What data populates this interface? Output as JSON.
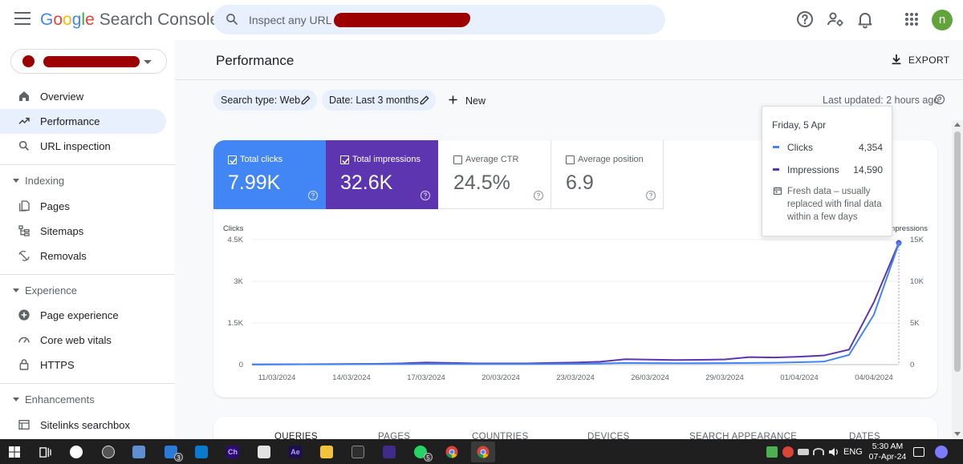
{
  "header": {
    "logo_letters": [
      "G",
      "o",
      "o",
      "g",
      "l",
      "e"
    ],
    "product_name": "Search Console",
    "search_placeholder": "Inspect any URL in",
    "help_icon": "help-icon",
    "account_icon": "manage-users-icon",
    "notifications_icon": "bell-icon",
    "apps_icon": "apps-grid-icon",
    "avatar_letter": "n"
  },
  "sidebar": {
    "items": [
      {
        "label": "Overview",
        "icon": "home-icon"
      },
      {
        "label": "Performance",
        "icon": "trending-up-icon",
        "active": true
      },
      {
        "label": "URL inspection",
        "icon": "search-icon"
      }
    ],
    "indexing": {
      "title": "Indexing",
      "items": [
        {
          "label": "Pages",
          "icon": "pages-icon"
        },
        {
          "label": "Sitemaps",
          "icon": "sitemap-icon"
        },
        {
          "label": "Removals",
          "icon": "removals-icon"
        }
      ]
    },
    "experience": {
      "title": "Experience",
      "items": [
        {
          "label": "Page experience",
          "icon": "plus-circle-icon"
        },
        {
          "label": "Core web vitals",
          "icon": "speedometer-icon"
        },
        {
          "label": "HTTPS",
          "icon": "lock-icon"
        }
      ]
    },
    "enhancements": {
      "title": "Enhancements",
      "items": [
        {
          "label": "Sitelinks searchbox",
          "icon": "sitelinks-icon"
        }
      ]
    }
  },
  "main": {
    "title": "Performance",
    "export_label": "EXPORT",
    "filters": {
      "search_type": "Search type: Web",
      "date": "Date: Last 3 months",
      "new_label": "New"
    },
    "last_updated": "Last updated: 2 hours ago",
    "metrics": [
      {
        "label": "Total clicks",
        "value": "7.99K",
        "checked": true
      },
      {
        "label": "Total impressions",
        "value": "32.6K",
        "checked": true
      },
      {
        "label": "Average CTR",
        "value": "24.5%",
        "checked": false
      },
      {
        "label": "Average position",
        "value": "6.9",
        "checked": false
      }
    ],
    "tabs": [
      "QUERIES",
      "PAGES",
      "COUNTRIES",
      "DEVICES",
      "SEARCH APPEARANCE",
      "DATES"
    ]
  },
  "tooltip": {
    "date": "Friday, 5 Apr",
    "rows": [
      {
        "name": "Clicks",
        "value": "4,354"
      },
      {
        "name": "Impressions",
        "value": "14,590"
      }
    ],
    "note": "Fresh data – usually replaced with final data within a few days"
  },
  "chart_data": {
    "type": "line",
    "left_axis_label": "Clicks",
    "right_axis_label": "Impressions",
    "left_ticks": [
      "4.5K",
      "3K",
      "1.5K",
      "0"
    ],
    "right_ticks": [
      "15K",
      "10K",
      "5K",
      "0"
    ],
    "x_tick_labels": [
      "11/03/2024",
      "14/03/2024",
      "17/03/2024",
      "20/03/2024",
      "23/03/2024",
      "26/03/2024",
      "29/03/2024",
      "01/04/2024",
      "04/04/2024"
    ],
    "left_range": [
      0,
      4500
    ],
    "right_range": [
      0,
      15000
    ],
    "x_dates": [
      "10/03",
      "11/03",
      "12/03",
      "13/03",
      "14/03",
      "15/03",
      "16/03",
      "17/03",
      "18/03",
      "19/03",
      "20/03",
      "21/03",
      "22/03",
      "23/03",
      "24/03",
      "25/03",
      "26/03",
      "27/03",
      "28/03",
      "29/03",
      "30/03",
      "31/03",
      "01/04",
      "02/04",
      "03/04",
      "04/04",
      "05/04"
    ],
    "series": [
      {
        "name": "Clicks",
        "color": "#4285f4",
        "axis": "left",
        "values": [
          5,
          8,
          10,
          12,
          15,
          18,
          20,
          30,
          25,
          20,
          22,
          20,
          25,
          30,
          40,
          60,
          55,
          50,
          50,
          55,
          60,
          70,
          85,
          110,
          350,
          1800,
          4354
        ]
      },
      {
        "name": "Impressions",
        "color": "#5e35b1",
        "axis": "left_scaled",
        "values": [
          30,
          40,
          50,
          60,
          80,
          100,
          150,
          250,
          200,
          150,
          150,
          150,
          200,
          250,
          350,
          650,
          600,
          550,
          580,
          620,
          900,
          850,
          950,
          1100,
          1800,
          7500,
          14590
        ]
      }
    ],
    "hover_index": 26
  },
  "taskbar": {
    "apps": [
      "windows-start-icon",
      "task-view-icon",
      "app-icon-1",
      "app-icon-2",
      "computer-icon",
      "vscode-blue-icon",
      "vscode-icon",
      "character-animator-icon",
      "calendar-app-icon",
      "after-effects-icon",
      "folder-icon",
      "tor-icon",
      "ad-icon",
      "whatsapp-icon",
      "chrome-icon",
      "chrome-active-icon"
    ],
    "ch_label": "Ch",
    "ae_label": "Ae",
    "badge_3": "3",
    "badge_5": "5",
    "language": "ENG",
    "time": "5:30 AM",
    "date": "07-Apr-24"
  }
}
